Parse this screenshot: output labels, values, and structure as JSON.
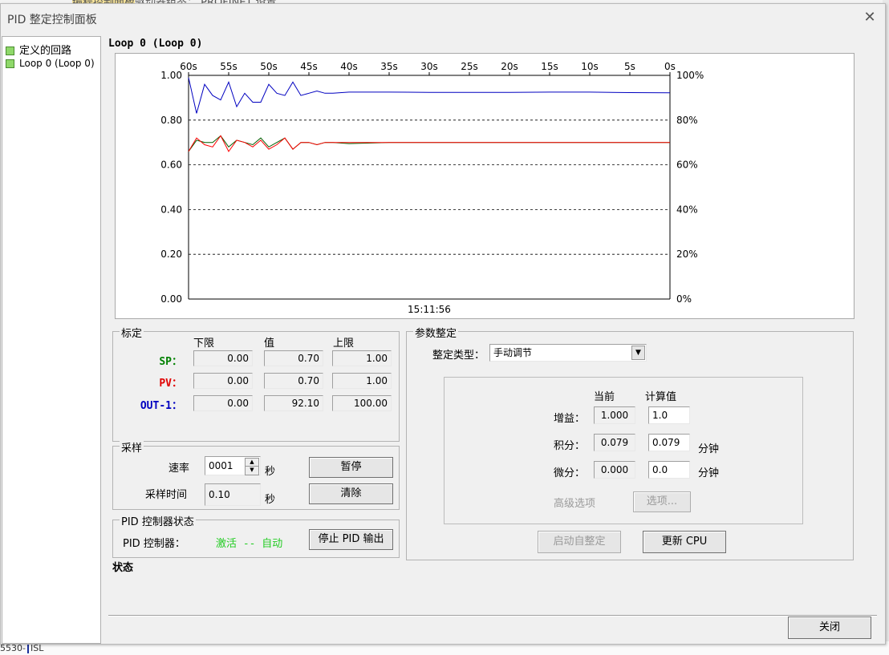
{
  "background": {
    "top_text_highlight": "编程控制面板",
    "top_text_rest": "驱动器组态：  PROFINET 设置",
    "bottom_left_text": "5530-",
    "bottom_left_text2": "ISL"
  },
  "window": {
    "title": "PID 整定控制面板",
    "close_glyph": "✕"
  },
  "tree": {
    "root_label": "定义的回路",
    "items": [
      {
        "label": "Loop 0 (Loop 0)"
      }
    ]
  },
  "loop_title": "Loop 0 (Loop 0)",
  "chart_data": {
    "type": "line",
    "x_tick_labels": [
      "60s",
      "55s",
      "50s",
      "45s",
      "40s",
      "35s",
      "30s",
      "25s",
      "20s",
      "15s",
      "10s",
      "5s",
      "0s"
    ],
    "y_left_ticks": [
      "1.00",
      "0.80",
      "0.60",
      "0.40",
      "0.20",
      "0.00"
    ],
    "y_right_ticks": [
      "100%",
      "80%",
      "60%",
      "40%",
      "20%",
      "0%"
    ],
    "ylim": [
      0,
      1
    ],
    "xlim": [
      60,
      0
    ],
    "timestamp": "15:11:56",
    "grid": "dashed-horizontal",
    "series": [
      {
        "color": "#0000c0",
        "x": [
          60,
          59,
          58,
          57,
          56,
          55,
          54,
          53,
          52,
          51,
          50,
          49,
          48,
          47,
          46,
          45,
          44,
          43,
          42,
          40,
          35,
          30,
          25,
          20,
          15,
          10,
          5,
          0
        ],
        "values": [
          0.99,
          0.83,
          0.96,
          0.91,
          0.89,
          0.97,
          0.86,
          0.92,
          0.88,
          0.88,
          0.96,
          0.92,
          0.91,
          0.97,
          0.91,
          0.92,
          0.93,
          0.92,
          0.92,
          0.925,
          0.925,
          0.924,
          0.924,
          0.924,
          0.925,
          0.925,
          0.923,
          0.922
        ]
      },
      {
        "color": "#006000",
        "x": [
          60,
          59,
          58,
          57,
          56,
          55,
          54,
          53,
          52,
          51,
          50,
          49,
          48,
          47,
          46,
          45,
          44,
          43,
          42,
          40,
          35,
          30,
          25,
          20,
          15,
          10,
          5,
          0
        ],
        "values": [
          0.66,
          0.71,
          0.7,
          0.7,
          0.73,
          0.68,
          0.71,
          0.7,
          0.69,
          0.72,
          0.68,
          0.7,
          0.72,
          0.67,
          0.7,
          0.7,
          0.69,
          0.7,
          0.7,
          0.695,
          0.7,
          0.7,
          0.7,
          0.7,
          0.7,
          0.7,
          0.7,
          0.7
        ]
      },
      {
        "color": "#ff0000",
        "x": [
          60,
          59,
          58,
          57,
          56,
          55,
          54,
          53,
          52,
          51,
          50,
          49,
          48,
          47,
          46,
          45,
          44,
          43,
          42,
          40,
          35,
          30,
          25,
          20,
          15,
          10,
          5,
          0
        ],
        "values": [
          0.66,
          0.72,
          0.69,
          0.68,
          0.73,
          0.66,
          0.71,
          0.7,
          0.68,
          0.71,
          0.67,
          0.69,
          0.72,
          0.67,
          0.7,
          0.7,
          0.69,
          0.7,
          0.7,
          0.7,
          0.7,
          0.7,
          0.7,
          0.7,
          0.7,
          0.7,
          0.7,
          0.7
        ]
      }
    ]
  },
  "scale": {
    "title": "标定",
    "col_low": "下限",
    "col_value": "值",
    "col_high": "上限",
    "rows": [
      {
        "label": "SP：",
        "color": "#008000",
        "low": "0.00",
        "value": "0.70",
        "high": "1.00"
      },
      {
        "label": "PV：",
        "color": "#e00000",
        "low": "0.00",
        "value": "0.70",
        "high": "1.00"
      },
      {
        "label": "OUT-1：",
        "color": "#0000c0",
        "low": "0.00",
        "value": "92.10",
        "high": "100.00"
      }
    ]
  },
  "sampling": {
    "title": "采样",
    "rate_label": "速率",
    "rate_value": "0001",
    "rate_unit": "秒",
    "time_label": "采样时间",
    "time_value": "0.10",
    "time_unit": "秒",
    "pause_button": "暂停",
    "clear_button": "清除"
  },
  "controller_status": {
    "title": "PID 控制器状态",
    "label": "PID 控制器：",
    "value": "激活 -- 自动",
    "value_color": "#22cc22",
    "stop_button": "停止 PID 输出"
  },
  "status_label": "状态",
  "tuning": {
    "title": "参数整定",
    "type_label": "整定类型：",
    "type_value": "手动调节",
    "col_current": "当前",
    "col_calculated": "计算值",
    "gain_label": "增益：",
    "gain_current": "1.000",
    "gain_calc": "1.0",
    "integral_label": "积分：",
    "integral_current": "0.079",
    "integral_calc": "0.079",
    "integral_unit": "分钟",
    "derivative_label": "微分：",
    "derivative_current": "0.000",
    "derivative_calc": "0.0",
    "derivative_unit": "分钟",
    "advanced_label": "高级选项",
    "options_button": "选项...",
    "auto_tune_button": "启动自整定",
    "update_cpu_button": "更新 CPU"
  },
  "close_button": "关闭"
}
